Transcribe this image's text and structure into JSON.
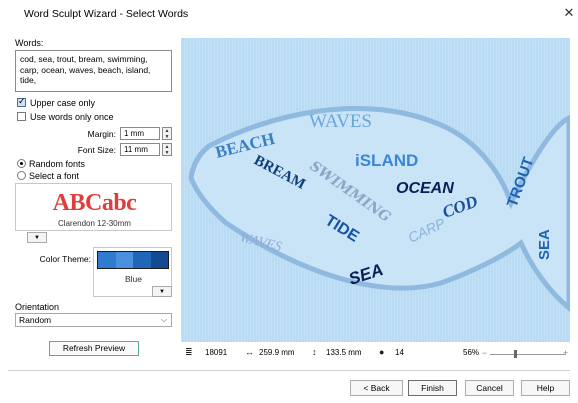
{
  "window": {
    "title": "Word Sculpt Wizard - Select Words",
    "close_glyph": "✕"
  },
  "words": {
    "label": "Words:",
    "value": "cod, sea, trout, bream, swimming, carp, ocean, waves, beach, island, tide,"
  },
  "options": {
    "upper_case_label": "Upper case only",
    "upper_case_checked": true,
    "use_once_label": "Use words only once",
    "use_once_checked": false
  },
  "margin": {
    "label": "Margin:",
    "value": "1 mm"
  },
  "font_size": {
    "label": "Font Size:",
    "value": "11 mm"
  },
  "font_mode": {
    "random_label": "Random fonts",
    "select_label": "Select a font",
    "selected": "random"
  },
  "font_preview": {
    "sample": "ABCabc",
    "name": "Clarendon 12-30mm",
    "sample_color": "#e03d3d"
  },
  "color_theme": {
    "label": "Color Theme:",
    "name": "Blue",
    "swatches": [
      "#2f7bd0",
      "#4a90dc",
      "#1f65b8",
      "#134a91"
    ]
  },
  "orientation": {
    "label": "Orientation",
    "value": "Random"
  },
  "refresh_label": "Refresh Preview",
  "canvas": {
    "background": "#b9dbf3",
    "fish_fill": "#c9e3f7",
    "fish_stroke": "#8fb9df",
    "words": [
      "BEACH",
      "WAVES",
      "iSLAND",
      "BREAM",
      "SWIMMING",
      "OCEAN",
      "COD",
      "TROUT",
      "CARP",
      "TIDE",
      "WAVES",
      "SEA",
      "SEA"
    ]
  },
  "status": {
    "stitches": "18091",
    "width": "259.9 mm",
    "height": "133.5 mm",
    "colors": "14",
    "zoom": "56%",
    "zoom_fraction": 0.33
  },
  "buttons": {
    "back": "< Back",
    "finish": "Finish",
    "cancel": "Cancel",
    "help": "Help"
  }
}
